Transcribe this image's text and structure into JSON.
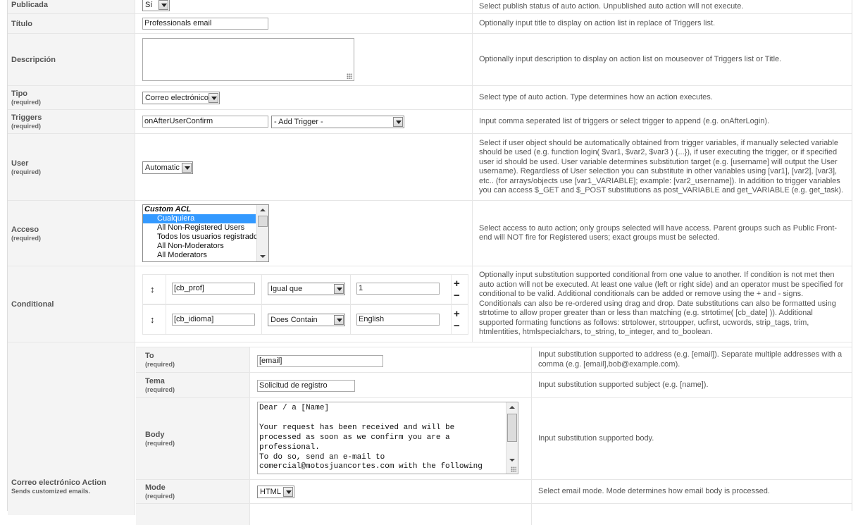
{
  "colors": {
    "label_bg": "#f4f4f4",
    "border": "#e6e6e6",
    "selection": "#3399ff",
    "help_text": "#555555"
  },
  "rows": {
    "published": {
      "label": "Publicada",
      "value": "Sí",
      "help": "Select publish status of auto action. Unpublished auto action will not execute."
    },
    "title": {
      "label": "Título",
      "value": "Professionals email",
      "help": "Optionally input title to display on action list in replace of Triggers list."
    },
    "description": {
      "label": "Descripción",
      "value": "",
      "help": "Optionally input description to display on action list on mouseover of Triggers list or Title."
    },
    "type": {
      "label": "Tipo",
      "required": "(required)",
      "value": "Correo electrónico",
      "help": "Select type of auto action. Type determines how an action executes."
    },
    "triggers": {
      "label": "Triggers",
      "required": "(required)",
      "value": "onAfterUserConfirm",
      "select_value": "- Add Trigger -",
      "help": "Input comma seperated list of triggers or select trigger to append (e.g. onAfterLogin)."
    },
    "user": {
      "label": "User",
      "required": "(required)",
      "value": "Automatic",
      "help": "Select if user object should be automatically obtained from trigger variables, if manually selected variable should be used (e.g. function login( $var1, $var2, $var3 ) {...}), if user executing the trigger, or if specified user id should be used. User variable determines substitution target (e.g. [username] will output the User username). Regardless of User selection you can substitute in other variables using [var1], [var2], [var3], etc.. (for arrays/objects use [var1_VARIABLE]; example: [var2_username]). In addition to trigger variables you can access $_GET and $_POST substitutions as post_VARIABLE and get_VARIABLE (e.g. get_task)."
    },
    "access": {
      "label": "Acceso",
      "required": "(required)",
      "options": [
        "Custom ACL",
        "Cualquiera",
        "All Non-Registered Users",
        "Todos los usuarios registrados",
        "All Non-Moderators",
        "All Moderators"
      ],
      "selected": "Cualquiera",
      "help": "Select access to auto action; only groups selected will have access. Parent groups such as Public Front-end will NOT fire for Registered users; exact groups must be selected."
    },
    "conditional": {
      "label": "Conditional",
      "rows": [
        {
          "left": "[cb_prof]",
          "operator": "Igual que",
          "right": "1"
        },
        {
          "left": "[cb_idioma]",
          "operator": "Does Contain",
          "right": "English"
        }
      ],
      "drag_icon": "↕",
      "plus": "+",
      "minus": "−",
      "help": "Optionally input substitution supported conditional from one value to another. If condition is not met then auto action will not be executed. At least one value (left or right side) and an operator must be specified for conditional to be valid. Additional conditionals can be added or remove using the + and - signs. Conditionals can also be re-ordered using drag and drop. Date substitutions can also be formatted using strtotime to allow proper greater than or less than matching (e.g. strtotime( [cb_date] )). Additional supported formating functions as follows: strtolower, strtoupper, ucfirst, ucwords, strip_tags, trim, htmlentities, htmlspecialchars, to_string, to_integer, and to_boolean."
    },
    "email_action": {
      "label": "Correo electrónico Action",
      "sub": "Sends customized emails.",
      "to": {
        "label": "To",
        "required": "(required)",
        "value": "[email]",
        "help": "Input substitution supported to address (e.g. [email]). Separate multiple addresses with a comma (e.g. [email],bob@example.com)."
      },
      "subject": {
        "label": "Tema",
        "required": "(required)",
        "value": "Solicitud de registro",
        "help": "Input substitution supported subject (e.g. [name])."
      },
      "body": {
        "label": "Body",
        "required": "(required)",
        "value": "Dear / a [Name]\n\nYour request has been received and will be\nprocessed as soon as we confirm you are a\nprofessional.\nTo do so, send an e-mail to\ncomercial@motosjuancortes.com with the following",
        "help": "Input substitution supported body."
      },
      "mode": {
        "label": "Mode",
        "required": "(required)",
        "value": "HTML",
        "help": "Select email mode. Mode determines how email body is processed."
      }
    }
  }
}
